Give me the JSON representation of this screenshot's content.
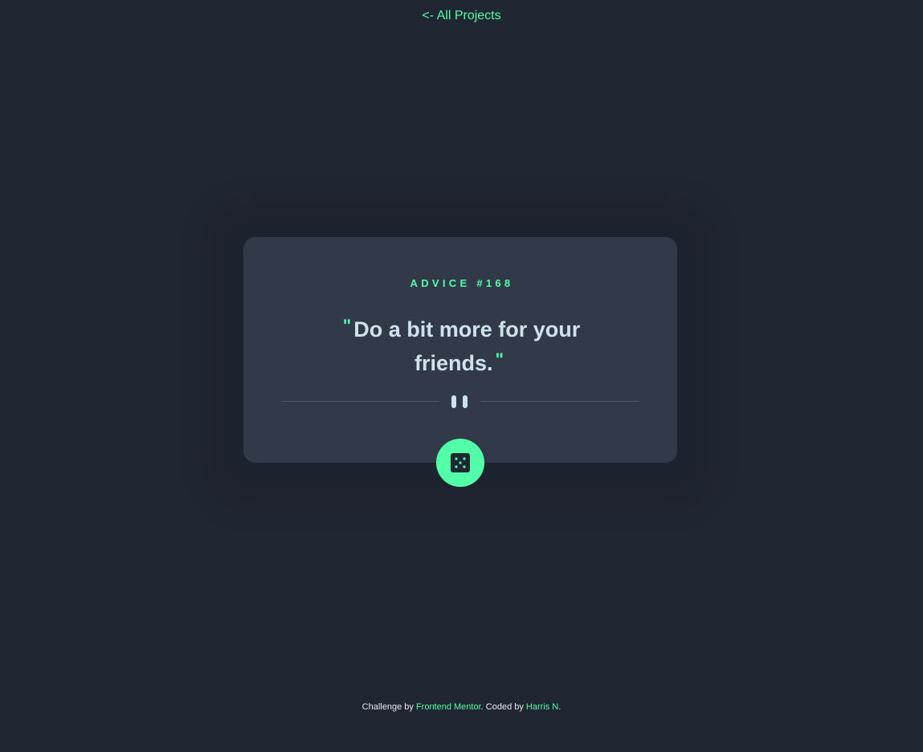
{
  "nav": {
    "back_link": "<- All Projects"
  },
  "card": {
    "advice_label": "ADVICE #168",
    "advice_text": "Do a bit more for your friends.",
    "open_quote": "\"",
    "close_quote": "\"",
    "divider_icon": "pause-icon",
    "button_icon": "dice-icon"
  },
  "footer": {
    "challenge_by": "Challenge by",
    "frontend_mentor": "Frontend Mentor",
    "coded_by": ". Coded by",
    "author": "Harris N",
    "end": "."
  },
  "colors": {
    "background": "#202632",
    "card": "#323a49",
    "accent": "#52ffa8",
    "text": "#cee3e9",
    "divider": "#4f5d74"
  }
}
